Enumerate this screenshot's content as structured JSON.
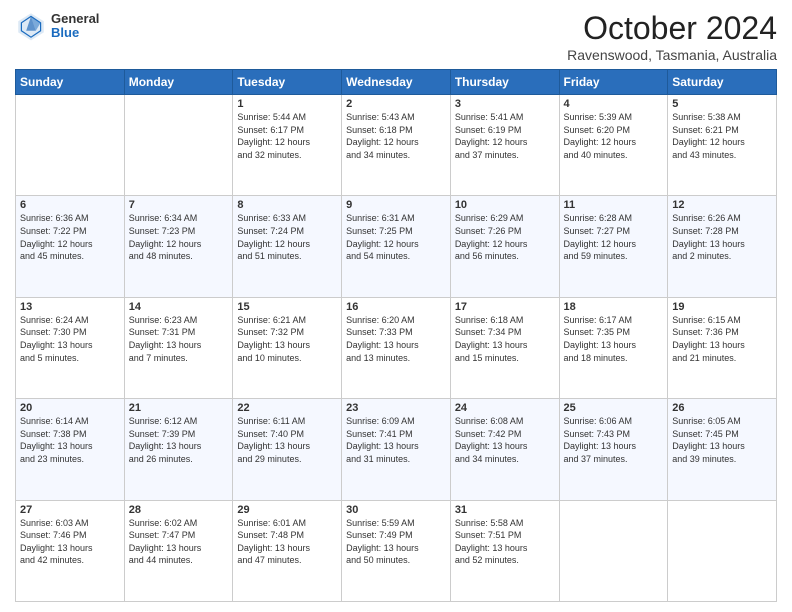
{
  "header": {
    "logo_general": "General",
    "logo_blue": "Blue",
    "month_title": "October 2024",
    "subtitle": "Ravenswood, Tasmania, Australia"
  },
  "weekdays": [
    "Sunday",
    "Monday",
    "Tuesday",
    "Wednesday",
    "Thursday",
    "Friday",
    "Saturday"
  ],
  "weeks": [
    [
      {
        "day": "",
        "info": ""
      },
      {
        "day": "",
        "info": ""
      },
      {
        "day": "1",
        "info": "Sunrise: 5:44 AM\nSunset: 6:17 PM\nDaylight: 12 hours\nand 32 minutes."
      },
      {
        "day": "2",
        "info": "Sunrise: 5:43 AM\nSunset: 6:18 PM\nDaylight: 12 hours\nand 34 minutes."
      },
      {
        "day": "3",
        "info": "Sunrise: 5:41 AM\nSunset: 6:19 PM\nDaylight: 12 hours\nand 37 minutes."
      },
      {
        "day": "4",
        "info": "Sunrise: 5:39 AM\nSunset: 6:20 PM\nDaylight: 12 hours\nand 40 minutes."
      },
      {
        "day": "5",
        "info": "Sunrise: 5:38 AM\nSunset: 6:21 PM\nDaylight: 12 hours\nand 43 minutes."
      }
    ],
    [
      {
        "day": "6",
        "info": "Sunrise: 6:36 AM\nSunset: 7:22 PM\nDaylight: 12 hours\nand 45 minutes."
      },
      {
        "day": "7",
        "info": "Sunrise: 6:34 AM\nSunset: 7:23 PM\nDaylight: 12 hours\nand 48 minutes."
      },
      {
        "day": "8",
        "info": "Sunrise: 6:33 AM\nSunset: 7:24 PM\nDaylight: 12 hours\nand 51 minutes."
      },
      {
        "day": "9",
        "info": "Sunrise: 6:31 AM\nSunset: 7:25 PM\nDaylight: 12 hours\nand 54 minutes."
      },
      {
        "day": "10",
        "info": "Sunrise: 6:29 AM\nSunset: 7:26 PM\nDaylight: 12 hours\nand 56 minutes."
      },
      {
        "day": "11",
        "info": "Sunrise: 6:28 AM\nSunset: 7:27 PM\nDaylight: 12 hours\nand 59 minutes."
      },
      {
        "day": "12",
        "info": "Sunrise: 6:26 AM\nSunset: 7:28 PM\nDaylight: 13 hours\nand 2 minutes."
      }
    ],
    [
      {
        "day": "13",
        "info": "Sunrise: 6:24 AM\nSunset: 7:30 PM\nDaylight: 13 hours\nand 5 minutes."
      },
      {
        "day": "14",
        "info": "Sunrise: 6:23 AM\nSunset: 7:31 PM\nDaylight: 13 hours\nand 7 minutes."
      },
      {
        "day": "15",
        "info": "Sunrise: 6:21 AM\nSunset: 7:32 PM\nDaylight: 13 hours\nand 10 minutes."
      },
      {
        "day": "16",
        "info": "Sunrise: 6:20 AM\nSunset: 7:33 PM\nDaylight: 13 hours\nand 13 minutes."
      },
      {
        "day": "17",
        "info": "Sunrise: 6:18 AM\nSunset: 7:34 PM\nDaylight: 13 hours\nand 15 minutes."
      },
      {
        "day": "18",
        "info": "Sunrise: 6:17 AM\nSunset: 7:35 PM\nDaylight: 13 hours\nand 18 minutes."
      },
      {
        "day": "19",
        "info": "Sunrise: 6:15 AM\nSunset: 7:36 PM\nDaylight: 13 hours\nand 21 minutes."
      }
    ],
    [
      {
        "day": "20",
        "info": "Sunrise: 6:14 AM\nSunset: 7:38 PM\nDaylight: 13 hours\nand 23 minutes."
      },
      {
        "day": "21",
        "info": "Sunrise: 6:12 AM\nSunset: 7:39 PM\nDaylight: 13 hours\nand 26 minutes."
      },
      {
        "day": "22",
        "info": "Sunrise: 6:11 AM\nSunset: 7:40 PM\nDaylight: 13 hours\nand 29 minutes."
      },
      {
        "day": "23",
        "info": "Sunrise: 6:09 AM\nSunset: 7:41 PM\nDaylight: 13 hours\nand 31 minutes."
      },
      {
        "day": "24",
        "info": "Sunrise: 6:08 AM\nSunset: 7:42 PM\nDaylight: 13 hours\nand 34 minutes."
      },
      {
        "day": "25",
        "info": "Sunrise: 6:06 AM\nSunset: 7:43 PM\nDaylight: 13 hours\nand 37 minutes."
      },
      {
        "day": "26",
        "info": "Sunrise: 6:05 AM\nSunset: 7:45 PM\nDaylight: 13 hours\nand 39 minutes."
      }
    ],
    [
      {
        "day": "27",
        "info": "Sunrise: 6:03 AM\nSunset: 7:46 PM\nDaylight: 13 hours\nand 42 minutes."
      },
      {
        "day": "28",
        "info": "Sunrise: 6:02 AM\nSunset: 7:47 PM\nDaylight: 13 hours\nand 44 minutes."
      },
      {
        "day": "29",
        "info": "Sunrise: 6:01 AM\nSunset: 7:48 PM\nDaylight: 13 hours\nand 47 minutes."
      },
      {
        "day": "30",
        "info": "Sunrise: 5:59 AM\nSunset: 7:49 PM\nDaylight: 13 hours\nand 50 minutes."
      },
      {
        "day": "31",
        "info": "Sunrise: 5:58 AM\nSunset: 7:51 PM\nDaylight: 13 hours\nand 52 minutes."
      },
      {
        "day": "",
        "info": ""
      },
      {
        "day": "",
        "info": ""
      }
    ]
  ]
}
